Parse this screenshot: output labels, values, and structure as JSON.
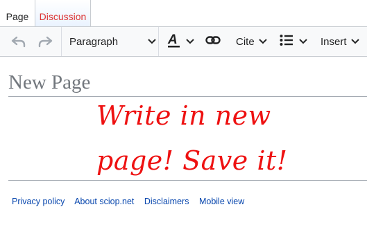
{
  "tabs": [
    {
      "label": "Page"
    },
    {
      "label": "Discussion"
    }
  ],
  "toolbar": {
    "undo_icon": "undo-icon",
    "redo_icon": "redo-icon",
    "format_label": "Paragraph",
    "text_style_icon": "text-style-icon",
    "link_icon": "link-icon",
    "cite_label": "Cite",
    "list_icon": "bullet-list-icon",
    "insert_label": "Insert"
  },
  "page": {
    "title_placeholder": "New Page",
    "body_line1": "Write in new",
    "body_line2": "page! Save it!"
  },
  "footer": {
    "links": [
      "Privacy policy",
      "About sciop.net",
      "Disclaimers",
      "Mobile view"
    ]
  },
  "colors": {
    "accent_red": "#ee1111",
    "link_blue": "#0645ad",
    "discussion_red": "#dd3333"
  }
}
